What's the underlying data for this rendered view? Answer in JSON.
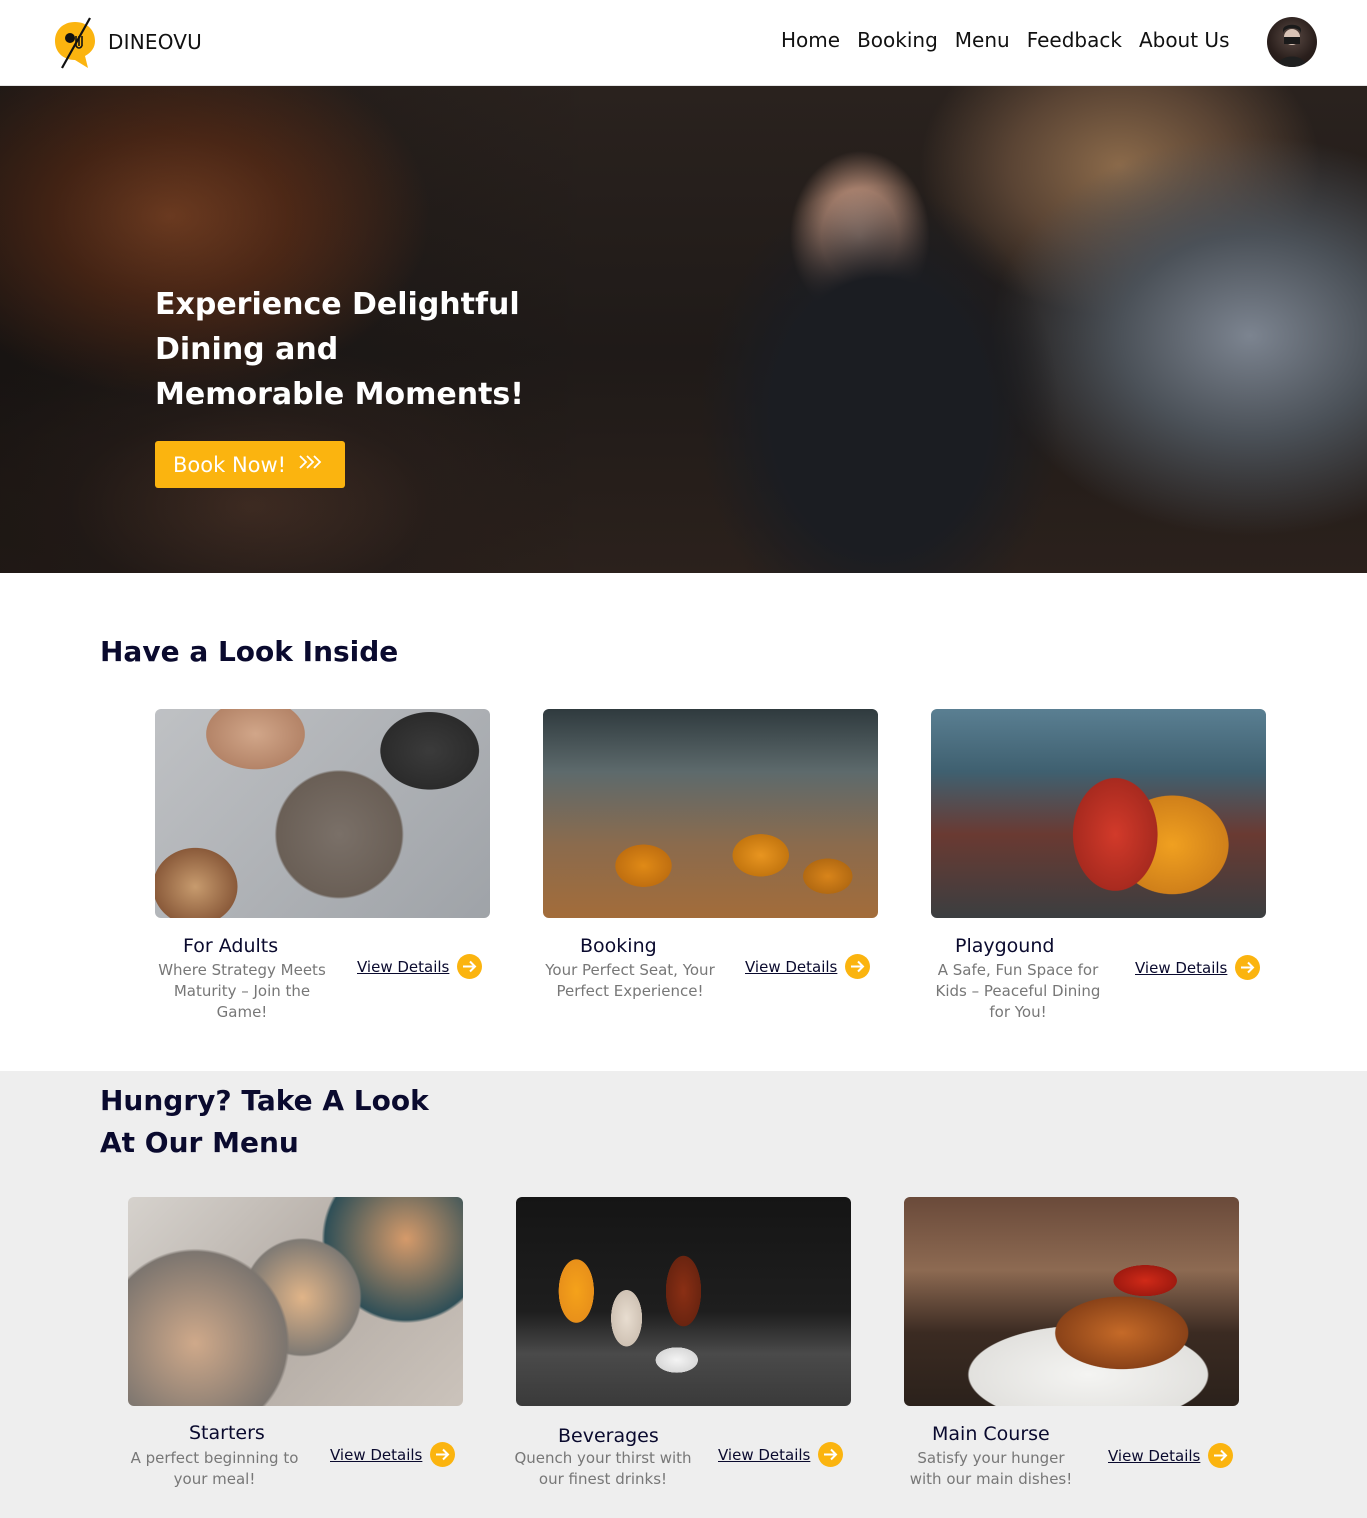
{
  "brand": {
    "name": "DINEOVU"
  },
  "nav": {
    "links": [
      {
        "label": "Home"
      },
      {
        "label": "Booking"
      },
      {
        "label": "Menu"
      },
      {
        "label": "Feedback"
      },
      {
        "label": "About Us"
      }
    ]
  },
  "hero": {
    "title": "Experience Delightful Dining and Memorable Moments!",
    "cta_label": "Book Now!",
    "cta_icon": "triple-chevron-right-icon"
  },
  "inside": {
    "title": "Have a Look Inside",
    "cards": [
      {
        "name": "For Adults",
        "desc": "Where Strategy Meets Maturity – Join the Game!",
        "link": "View Details"
      },
      {
        "name": "Booking",
        "desc": "Your Perfect Seat, Your Perfect Experience!",
        "link": "View Details"
      },
      {
        "name": "Playgound",
        "desc": "A Safe, Fun Space for Kids – Peaceful Dining for You!",
        "link": "View Details"
      }
    ]
  },
  "menu": {
    "title": "Hungry? Take A Look At Our Menu",
    "cards": [
      {
        "name": "Starters",
        "desc": "A perfect beginning to your meal!",
        "link": "View Details"
      },
      {
        "name": "Beverages",
        "desc": "Quench your thirst with our finest drinks!",
        "link": "View Details"
      },
      {
        "name": "Main Course",
        "desc": "Satisfy your hunger with our main dishes!",
        "link": "View Details"
      }
    ]
  },
  "colors": {
    "accent": "#fbb40f",
    "heading": "#0a0a2e",
    "muted": "#777777",
    "menu_bg": "#eeeeee"
  }
}
